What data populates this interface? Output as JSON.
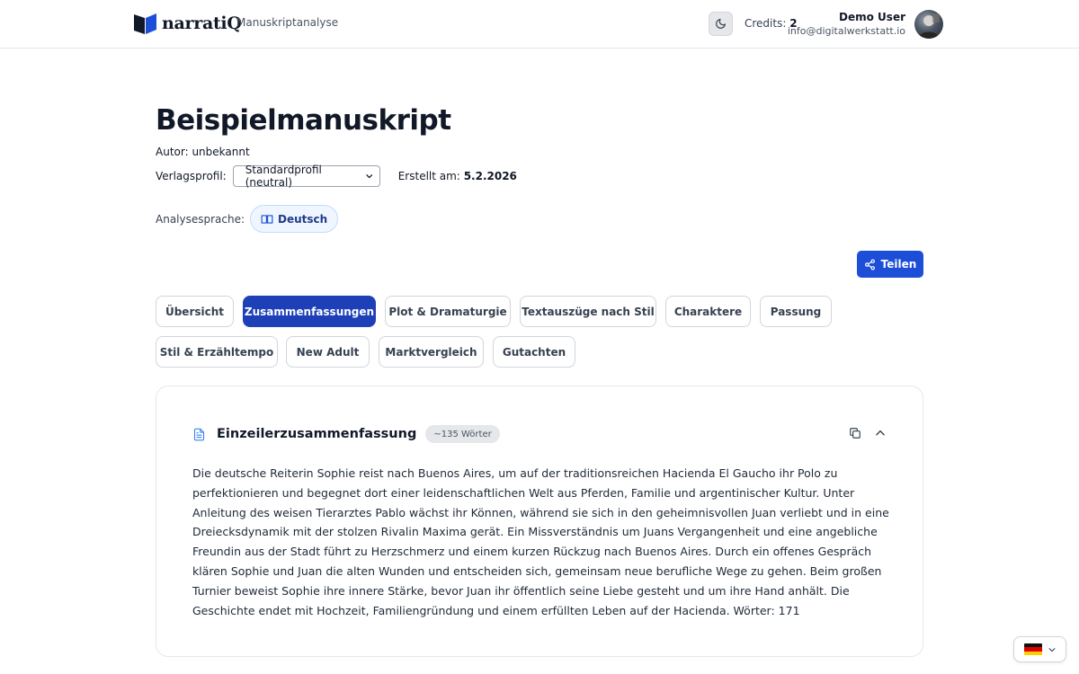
{
  "header": {
    "logo_text": "narratiQ",
    "app_subtitle": "Manuskriptanalyse",
    "theme_icon": "moon-icon",
    "credits_label": "Credits:",
    "credits_value": "2",
    "user_name": "Demo User",
    "user_email": "info@digitalwerkstatt.io"
  },
  "manuscript": {
    "title": "Beispielmanuskript",
    "author": "Autor: unbekannt",
    "profile_label": "Verlagsprofil:",
    "profile_value": "Standardprofil (neutral)",
    "created_label": "Erstellt am:",
    "created_value": "5.2.2026",
    "language_label": "Analysesprache:",
    "language_value": "Deutsch"
  },
  "share_label": "Teilen",
  "tabs": [
    {
      "label": "Übersicht",
      "active": false
    },
    {
      "label": "Zusammenfassungen",
      "active": true
    },
    {
      "label": "Plot & Dramaturgie",
      "active": false
    },
    {
      "label": "Textauszüge nach Stil",
      "active": false
    },
    {
      "label": "Charaktere",
      "active": false
    },
    {
      "label": "Passung",
      "active": false
    },
    {
      "label": "Stil & Erzähltempo",
      "active": false
    },
    {
      "label": "New Adult",
      "active": false
    },
    {
      "label": "Marktvergleich",
      "active": false
    },
    {
      "label": "Gutachten",
      "active": false
    }
  ],
  "summary_card": {
    "title": "Einzeilerzusammenfassung",
    "word_badge": "~135 Wörter",
    "body": "Die deutsche Reiterin Sophie reist nach Buenos Aires, um auf der traditionsreichen Hacienda El Gaucho ihr Polo zu perfektionieren und begegnet dort einer leidenschaftlichen Welt aus Pferden, Familie und argentinischer Kultur. Unter Anleitung des weisen Tierarztes Pablo wächst ihr Können, während sie sich in den geheimnisvollen Juan verliebt und in eine Dreiecksdynamik mit der stolzen Rivalin Maxima gerät. Ein Missverständnis um Juans Vergangenheit und eine angebliche Freundin aus der Stadt führt zu Herzschmerz und einem kurzen Rückzug nach Buenos Aires. Durch ein offenes Gespräch klären Sophie und Juan die alten Wunden und entscheiden sich, gemeinsam neue berufliche Wege zu gehen. Beim großen Turnier beweist Sophie ihre innere Stärke, bevor Juan ihr öffentlich seine Liebe gesteht und um ihre Hand anhält. Die Geschichte endet mit Hochzeit, Familiengründung und einem erfüllten Leben auf der Hacienda. Wörter: 171"
  },
  "colors": {
    "primary": "#1d40b8",
    "share": "#1d4ed8",
    "lang_pill_bg": "#eff6ff",
    "doc_icon": "#3b82f6"
  }
}
